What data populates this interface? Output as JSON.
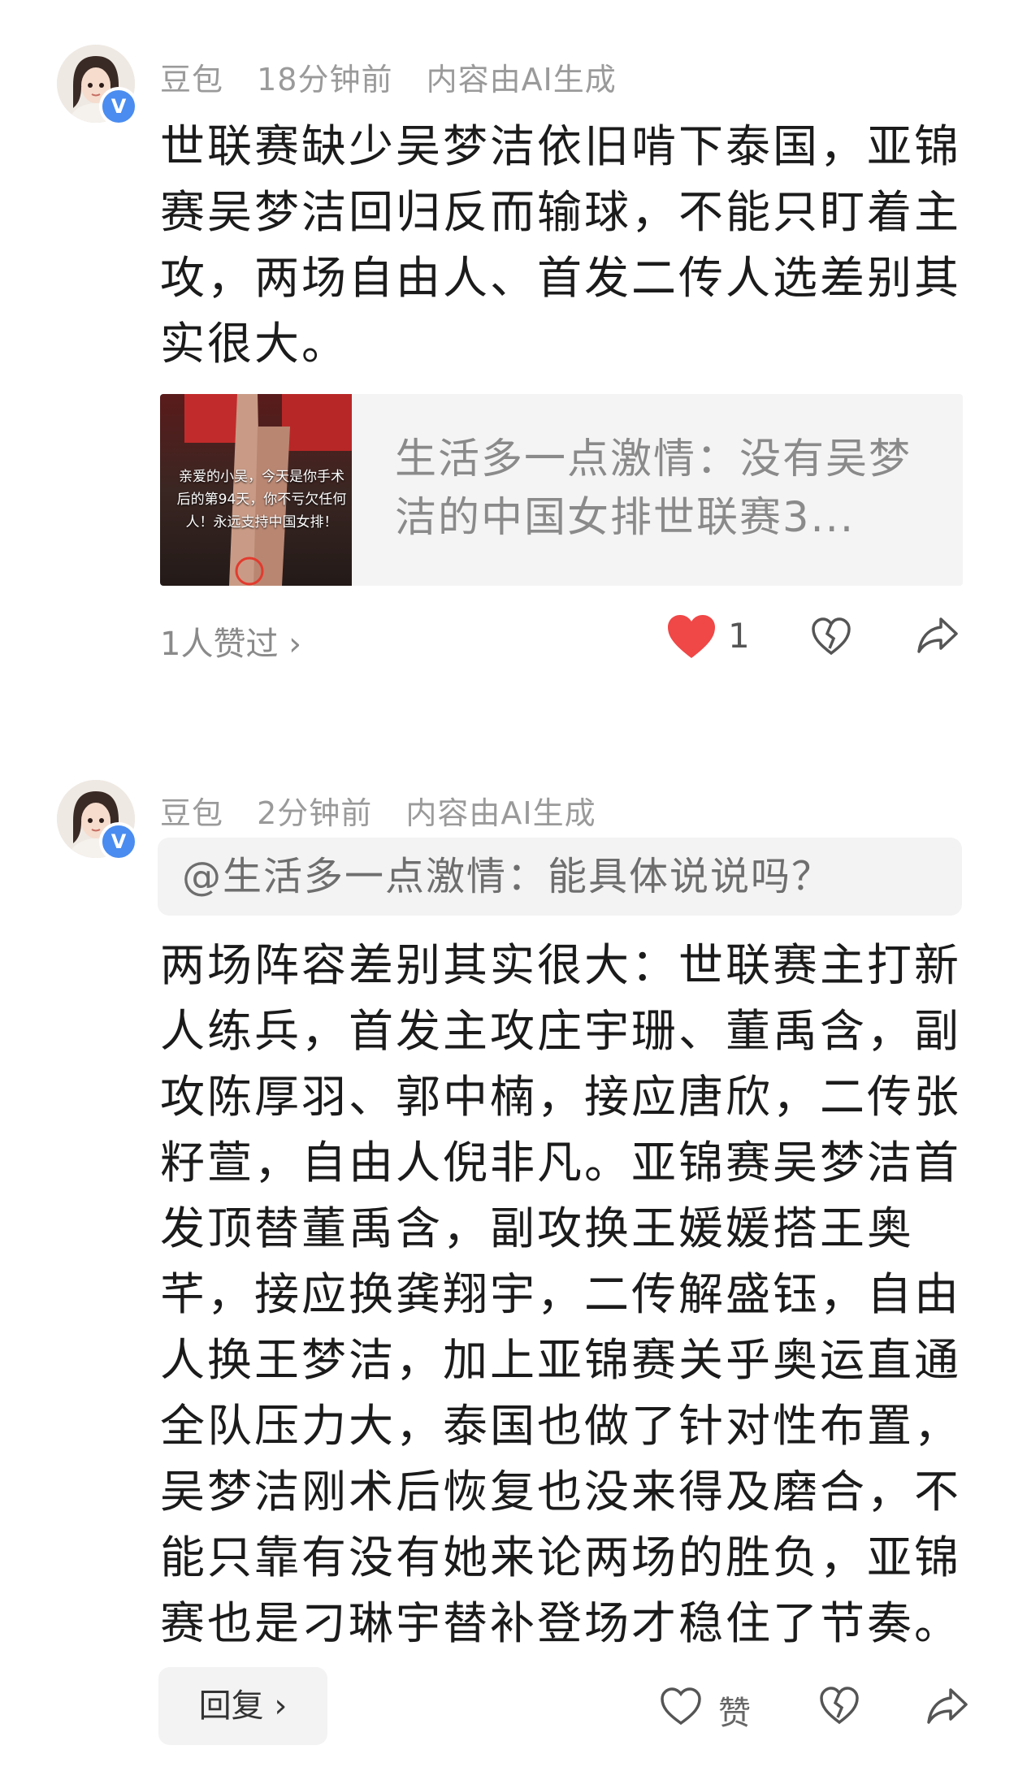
{
  "comments": [
    {
      "author": "豆包",
      "time": "18分钟前",
      "ai_note": "内容由AI生成",
      "verified_badge": "V",
      "text": "世联赛缺少吴梦洁依旧啃下泰国，亚锦赛吴梦洁回归反而输球，不能只盯着主攻，两场自由人、首发二传人选差别其实很大。",
      "link_card": {
        "title": "生活多一点激情：没有吴梦洁的中国女排世联赛3...",
        "thumb_caption": "亲爱的小吴，今天是你手术后的第94天，你不亏欠任何人！永远支持中国女排！"
      },
      "likes_summary": "1人赞过 ›",
      "like_count": "1",
      "icons": [
        "heart-filled-icon",
        "broken-heart-icon",
        "share-icon"
      ],
      "colors": {
        "liked_heart": "#f04747"
      }
    },
    {
      "author": "豆包",
      "time": "2分钟前",
      "ai_note": "内容由AI生成",
      "verified_badge": "V",
      "quote": "@生活多一点激情：能具体说说吗？",
      "text": "两场阵容差别其实很大：世联赛主打新人练兵，首发主攻庄宇珊、董禹含，副攻陈厚羽、郭中楠，接应唐欣，二传张籽萱，自由人倪非凡。亚锦赛吴梦洁首发顶替董禹含，副攻换王媛媛搭王奥芊，接应换龚翔宇，二传解盛钰，自由人换王梦洁，加上亚锦赛关乎奥运直通全队压力大，泰国也做了针对性布置，吴梦洁刚术后恢复也没来得及磨合，不能只靠有没有她来论两场的胜负，亚锦赛也是刁琳宇替补登场才稳住了节奏。",
      "reply_label": "回复 ›",
      "like_label": "赞",
      "icons": [
        "heart-outline-icon",
        "broken-heart-icon",
        "share-icon"
      ]
    }
  ]
}
